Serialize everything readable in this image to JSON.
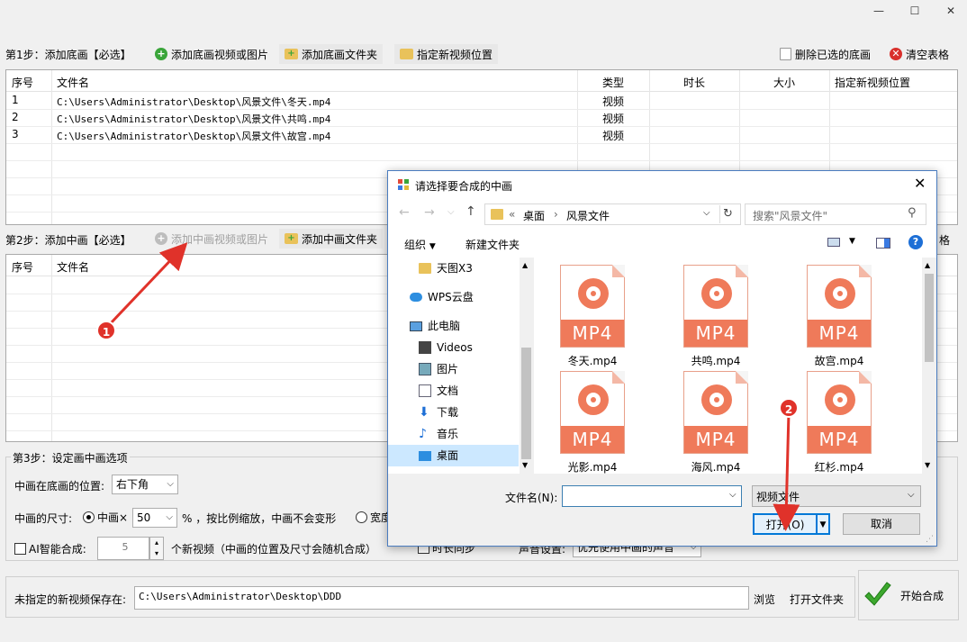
{
  "window": {
    "minimize": "—",
    "maximize": "☐",
    "close": "✕"
  },
  "step1": {
    "label": "第1步：添加底画【必选】",
    "add_video_btn": "添加底画视频或图片",
    "add_folder_btn": "添加底画文件夹",
    "set_location_btn": "指定新视频位置",
    "delete_selected_btn": "删除已选的底画",
    "clear_table_btn": "清空表格",
    "columns": [
      "序号",
      "文件名",
      "类型",
      "时长",
      "大小",
      "指定新视频位置"
    ],
    "rows": [
      {
        "index": "1",
        "filename": "C:\\Users\\Administrator\\Desktop\\风景文件\\冬天.mp4",
        "type": "视频"
      },
      {
        "index": "2",
        "filename": "C:\\Users\\Administrator\\Desktop\\风景文件\\共鸣.mp4",
        "type": "视频"
      },
      {
        "index": "3",
        "filename": "C:\\Users\\Administrator\\Desktop\\风景文件\\故宫.mp4",
        "type": "视频"
      }
    ]
  },
  "step2": {
    "label": "第2步：添加中画【必选】",
    "add_video_btn": "添加中画视频或图片",
    "add_folder_btn": "添加中画文件夹",
    "clear_table_partial": "格",
    "columns": [
      "序号",
      "文件名"
    ]
  },
  "step3": {
    "label": "第3步：设定画中画选项",
    "position_label": "中画在底画的位置:",
    "position_value": "右下角",
    "size_label": "中画的尺寸:",
    "size_radio_label": "中画×",
    "size_value": "50",
    "size_suffix": "% ，按比例缩放，中画不会变形",
    "width_radio_label": "宽度",
    "ai_label": "AI智能合成:",
    "ai_count": "5",
    "ai_suffix": "个新视频（中画的位置及尺寸会随机合成）",
    "sync_label": "时长同步",
    "audio_label": "声音设置:",
    "audio_value": "优先使用中画的声音"
  },
  "output": {
    "label": "未指定的新视频保存在:",
    "path": "C:\\Users\\Administrator\\Desktop\\DDD",
    "browse_btn": "浏览",
    "open_folder_btn": "打开文件夹",
    "start_btn": "开始合成"
  },
  "dialog": {
    "title": "请选择要合成的中画",
    "breadcrumb": [
      "«",
      "桌面",
      "›",
      "风景文件"
    ],
    "search_placeholder": "搜索\"风景文件\"",
    "organize": "组织",
    "new_folder": "新建文件夹",
    "nav": [
      {
        "label": "天图X3",
        "icon": "folder-icon"
      },
      {
        "label": "WPS云盘",
        "icon": "cloud-icon"
      },
      {
        "label": "此电脑",
        "icon": "computer-icon"
      },
      {
        "label": "Videos",
        "icon": "videos-icon"
      },
      {
        "label": "图片",
        "icon": "pictures-icon"
      },
      {
        "label": "文档",
        "icon": "documents-icon"
      },
      {
        "label": "下载",
        "icon": "download-icon"
      },
      {
        "label": "音乐",
        "icon": "music-icon"
      },
      {
        "label": "桌面",
        "icon": "desktop-icon"
      }
    ],
    "files": [
      {
        "name": "冬天.mp4",
        "ext": "MP4"
      },
      {
        "name": "共鸣.mp4",
        "ext": "MP4"
      },
      {
        "name": "故宫.mp4",
        "ext": "MP4"
      },
      {
        "name": "光影.mp4",
        "ext": "MP4"
      },
      {
        "name": "海风.mp4",
        "ext": "MP4"
      },
      {
        "name": "红杉.mp4",
        "ext": "MP4"
      }
    ],
    "filename_label": "文件名(N):",
    "filename_value": "",
    "filetype_value": "视频文件",
    "open_btn": "打开(O)",
    "cancel_btn": "取消"
  },
  "annotations": {
    "marker1": "1",
    "marker2": "2"
  },
  "colors": {
    "accent_red": "#e0322a",
    "mp4_orange": "#ef7a5a",
    "dialog_border": "#4a7cbf"
  }
}
